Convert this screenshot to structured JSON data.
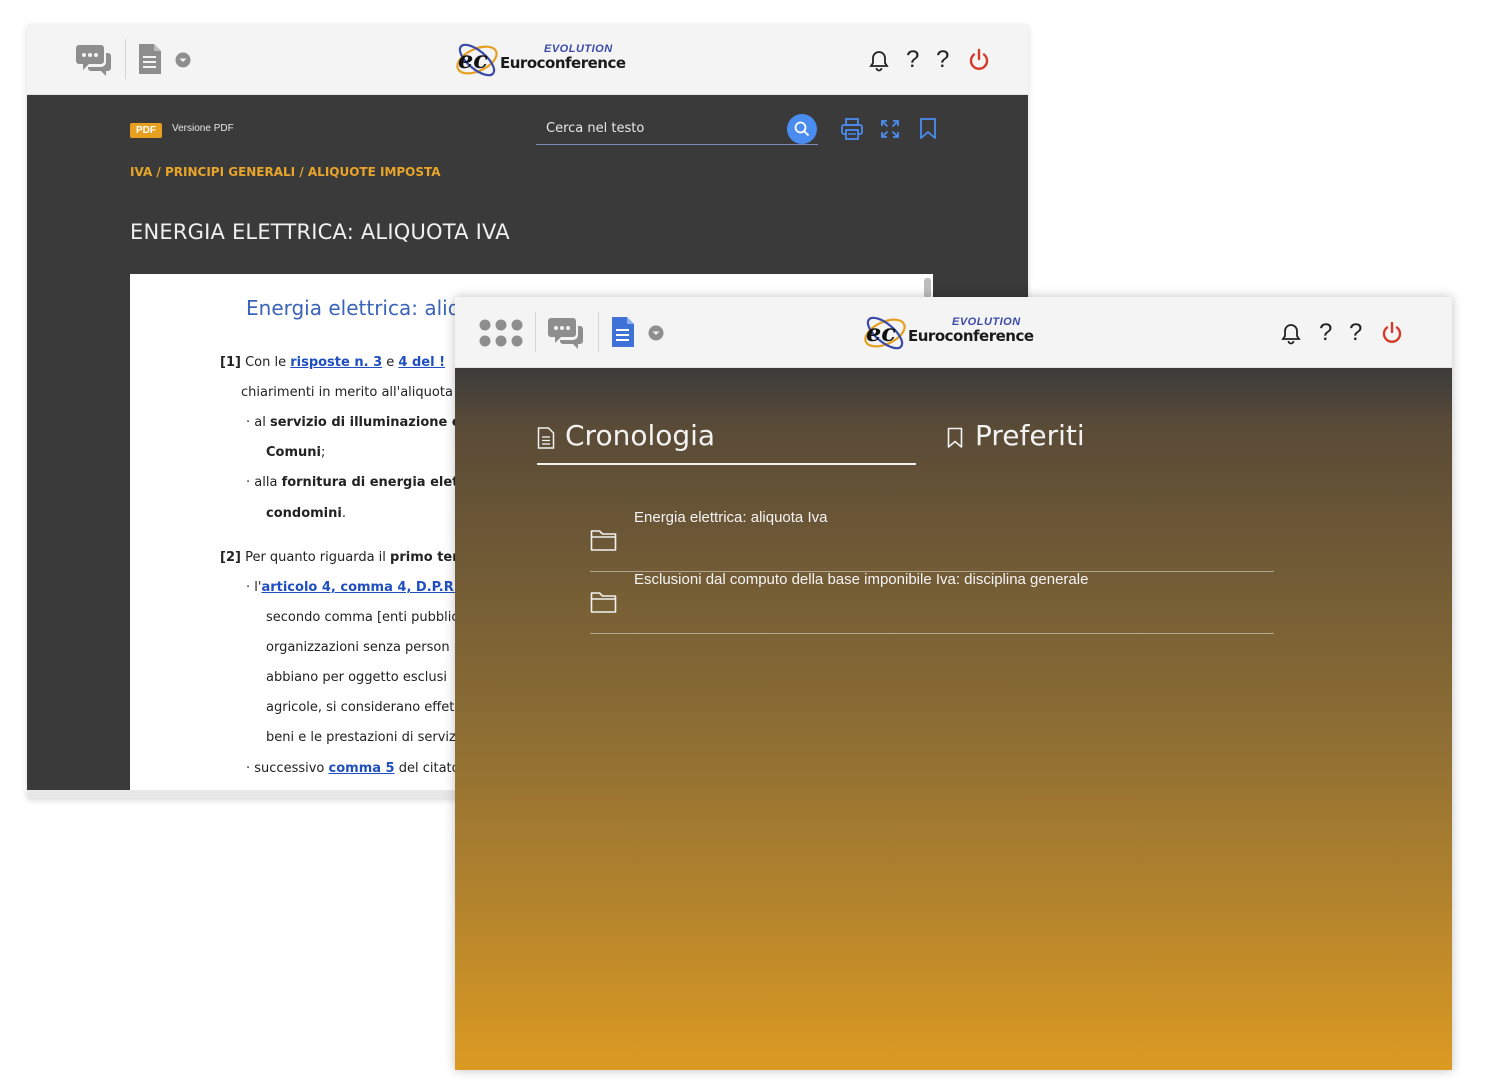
{
  "back": {
    "brand": {
      "evolution": "EVOLUTION",
      "name": "Euroconference"
    },
    "header": {
      "help1": "?",
      "help2": "?"
    },
    "toolbar": {
      "pdf_badge": "PDF",
      "pdf_label": "Versione PDF",
      "search_placeholder": "Cerca nel testo"
    },
    "breadcrumb": "IVA / PRINCIPI GENERALI / ALIQUOTE IMPOSTA",
    "title": "ENERGIA ELETTRICA: ALIQUOTA IVA",
    "doc": {
      "heading": "Energia elettrica: aliqu",
      "p1_num": "[1]",
      "p1_t1": " Con  le  ",
      "p1_link1": "risposte  n.  3",
      "p1_t2": "  e  ",
      "p1_link2": "4  del  !",
      "p1_l2": "chiarimenti in merito all'aliquota",
      "b1_pre": "· al ",
      "b1_bold": "servizio di illuminazione el",
      "b1_l2": "Comuni",
      "b1_l2_end": ";",
      "b2_pre": "· alla ",
      "b2_bold": "fornitura di energia elet",
      "b2_l2": "condomini",
      "b2_l2_end": ".",
      "p2_num": "[2]",
      "p2_t1": " Per quanto riguarda il ",
      "p2_bold": "primo tema",
      "b3_pre": "· l'",
      "b3_link": "articolo 4, comma 4, D.P.R. 63",
      "b3_l2": "secondo comma [enti pubblic",
      "b3_l3": "organizzazioni  senza  person",
      "b3_l4": "abbiano  per  oggetto  esclusi",
      "b3_l5": "agricole, si considerano effet",
      "b3_l6": "beni e le prestazioni di serviz",
      "b4_pre": "· successivo ",
      "b4_link": "comma 5",
      "b4_post": " del citato"
    }
  },
  "front": {
    "brand": {
      "evolution": "EVOLUTION",
      "name": "Euroconference"
    },
    "header": {
      "help1": "?",
      "help2": "?"
    },
    "tabs": [
      {
        "label": "Cronologia",
        "active": true
      },
      {
        "label": "Preferiti",
        "active": false
      }
    ],
    "history": [
      {
        "title": "Energia elettrica: aliquota Iva"
      },
      {
        "title": "Esclusioni dal computo della base imponibile Iva: disciplina generale"
      }
    ]
  },
  "colors": {
    "accent_orange": "#e8a52a",
    "link_blue": "#1f4fbf",
    "search_blue": "#4a8cf0",
    "power_red": "#d43a2a",
    "doc_icon_blue": "#3f72d6"
  },
  "icons": [
    "chat-icon",
    "document-icon",
    "chevron-down-icon",
    "bell-icon",
    "help-icon",
    "power-icon",
    "search-icon",
    "print-icon",
    "fullscreen-icon",
    "bookmark-icon",
    "apps-grid-icon",
    "folder-icon"
  ]
}
